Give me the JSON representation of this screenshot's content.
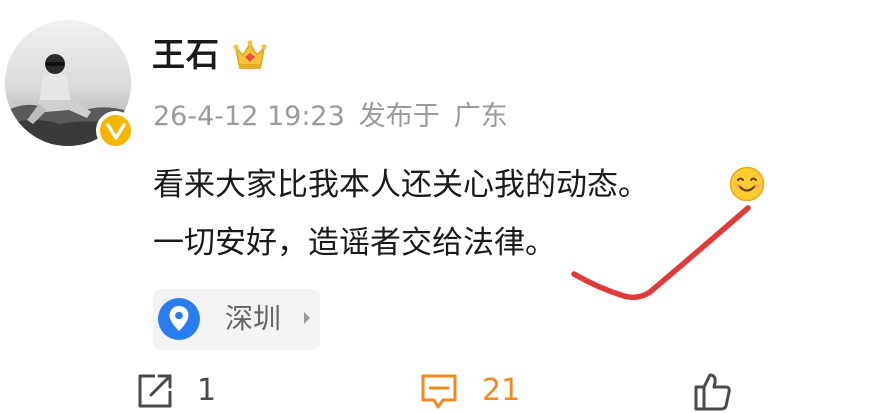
{
  "post": {
    "author": {
      "name": "王石",
      "verified": true,
      "verified_badge_color": "#f7b500",
      "level_icon": "crown-icon"
    },
    "meta": {
      "timestamp": "26-4-12 19:23",
      "location_prefix": "发布于",
      "province": "广东"
    },
    "content": {
      "line1": "看来大家比我本人还关心我的动态。",
      "line1_emoji": "smile-icon",
      "line2": "一切安好，造谣者交给法律。"
    },
    "location": {
      "label": "深圳",
      "icon": "location-pin-icon",
      "pin_color": "#2a7df0"
    },
    "actions": {
      "repost": {
        "icon": "repost-icon",
        "count": "1"
      },
      "comment": {
        "icon": "comment-icon",
        "count": "21",
        "color": "#f08a1e"
      },
      "like": {
        "icon": "like-icon"
      }
    },
    "annotation": {
      "type": "red-checkmark",
      "color": "#e03a3a"
    }
  }
}
